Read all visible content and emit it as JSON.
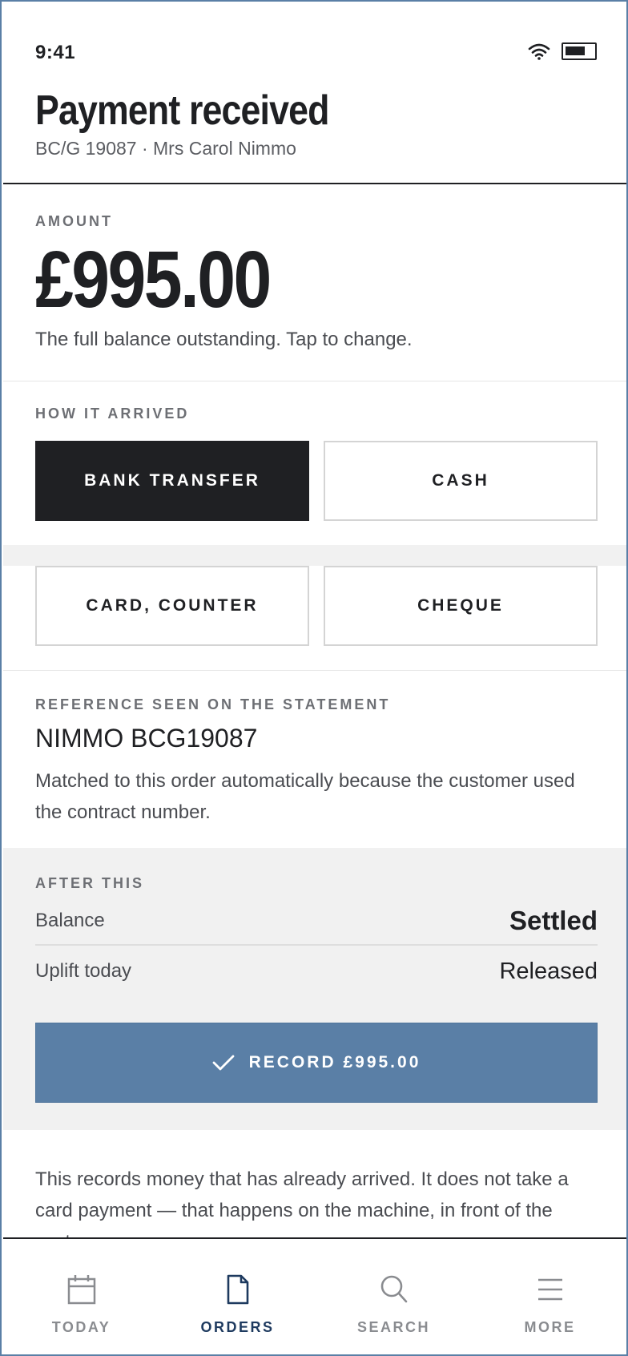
{
  "status_bar": {
    "time": "9:41"
  },
  "header": {
    "title": "Payment received",
    "subtitle": "BC/G 19087 · Mrs Carol Nimmo"
  },
  "amount": {
    "label": "AMOUNT",
    "value": "£995.00",
    "hint": "The full balance outstanding. Tap to change."
  },
  "method": {
    "label": "HOW IT ARRIVED",
    "options": [
      "BANK TRANSFER",
      "CASH",
      "CARD, COUNTER",
      "CHEQUE"
    ],
    "selected": "BANK TRANSFER"
  },
  "reference": {
    "label": "REFERENCE SEEN ON THE STATEMENT",
    "value": "NIMMO BCG19087",
    "note": "Matched to this order automatically because the customer used the contract number."
  },
  "after": {
    "label": "AFTER THIS",
    "rows": [
      {
        "label": "Balance",
        "value": "Settled"
      },
      {
        "label": "Uplift today",
        "value": "Released"
      }
    ]
  },
  "record_button": {
    "label": "RECORD £995.00",
    "icon": "check-icon"
  },
  "footnote": "This records money that has already arrived. It does not take a card payment — that happens on the machine, in front of the customer.",
  "tabbar": {
    "tabs": [
      {
        "label": "TODAY",
        "icon": "calendar-icon"
      },
      {
        "label": "ORDERS",
        "icon": "document-icon"
      },
      {
        "label": "SEARCH",
        "icon": "search-icon"
      },
      {
        "label": "MORE",
        "icon": "menu-icon"
      }
    ],
    "active": "ORDERS"
  },
  "colors": {
    "ink": "#1f2023",
    "accent": "#5a7fa6",
    "active_tab": "#1e3a5f",
    "inactive_tab": "#8a8c90",
    "panel": "#f1f1f1"
  }
}
